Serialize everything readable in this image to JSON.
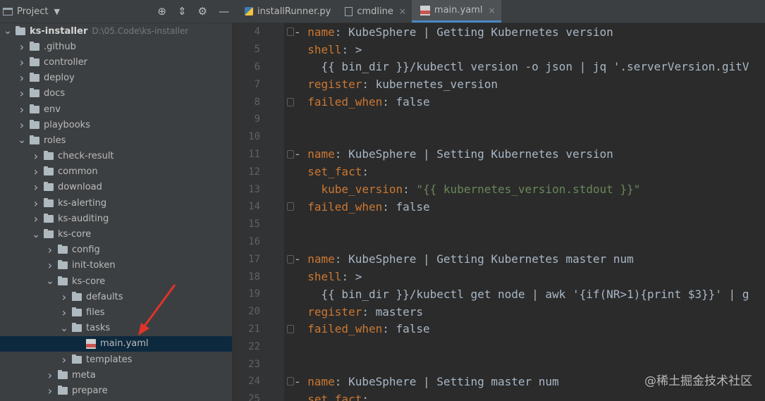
{
  "project_panel": {
    "title": "Project",
    "tree": [
      {
        "label": "ks-installer",
        "path": "D:\\05.Code\\ks-installer",
        "depth": 0,
        "expanded": true,
        "kind": "folder",
        "bold": true
      },
      {
        "label": ".github",
        "depth": 1,
        "expanded": false,
        "kind": "folder"
      },
      {
        "label": "controller",
        "depth": 1,
        "expanded": false,
        "kind": "folder"
      },
      {
        "label": "deploy",
        "depth": 1,
        "expanded": false,
        "kind": "folder"
      },
      {
        "label": "docs",
        "depth": 1,
        "expanded": false,
        "kind": "folder"
      },
      {
        "label": "env",
        "depth": 1,
        "expanded": false,
        "kind": "folder"
      },
      {
        "label": "playbooks",
        "depth": 1,
        "expanded": false,
        "kind": "folder"
      },
      {
        "label": "roles",
        "depth": 1,
        "expanded": true,
        "kind": "folder"
      },
      {
        "label": "check-result",
        "depth": 2,
        "expanded": false,
        "kind": "folder"
      },
      {
        "label": "common",
        "depth": 2,
        "expanded": false,
        "kind": "folder"
      },
      {
        "label": "download",
        "depth": 2,
        "expanded": false,
        "kind": "folder"
      },
      {
        "label": "ks-alerting",
        "depth": 2,
        "expanded": false,
        "kind": "folder"
      },
      {
        "label": "ks-auditing",
        "depth": 2,
        "expanded": false,
        "kind": "folder"
      },
      {
        "label": "ks-core",
        "depth": 2,
        "expanded": true,
        "kind": "folder"
      },
      {
        "label": "config",
        "depth": 3,
        "expanded": false,
        "kind": "folder"
      },
      {
        "label": "init-token",
        "depth": 3,
        "expanded": false,
        "kind": "folder"
      },
      {
        "label": "ks-core",
        "depth": 3,
        "expanded": true,
        "kind": "folder"
      },
      {
        "label": "defaults",
        "depth": 4,
        "expanded": false,
        "kind": "folder"
      },
      {
        "label": "files",
        "depth": 4,
        "expanded": false,
        "kind": "folder"
      },
      {
        "label": "tasks",
        "depth": 4,
        "expanded": true,
        "kind": "folder"
      },
      {
        "label": "main.yaml",
        "depth": 5,
        "kind": "yaml",
        "selected": true
      },
      {
        "label": "templates",
        "depth": 4,
        "expanded": false,
        "kind": "folder"
      },
      {
        "label": "meta",
        "depth": 3,
        "expanded": false,
        "kind": "folder"
      },
      {
        "label": "prepare",
        "depth": 3,
        "expanded": false,
        "kind": "folder"
      }
    ]
  },
  "tabs": [
    {
      "label": "installRunner.py",
      "icon": "python-file-icon",
      "active": false,
      "closable": false
    },
    {
      "label": "cmdline",
      "icon": "text-file-icon",
      "active": false,
      "closable": true
    },
    {
      "label": "main.yaml",
      "icon": "yaml-file-icon",
      "active": true,
      "closable": true
    }
  ],
  "editor": {
    "lines": [
      {
        "n": "4",
        "fold": true,
        "segs": [
          [
            "d",
            "- "
          ],
          [
            "k",
            "name"
          ],
          [
            "d",
            ": KubeSphere | Getting Kubernetes version"
          ]
        ]
      },
      {
        "n": "5",
        "fold": false,
        "segs": [
          [
            "d",
            "  "
          ],
          [
            "k",
            "shell"
          ],
          [
            "d",
            ": >"
          ]
        ]
      },
      {
        "n": "6",
        "fold": false,
        "segs": [
          [
            "d",
            "    {{ bin_dir }}/kubectl version -o json | jq '.serverVersion.gitV"
          ]
        ]
      },
      {
        "n": "7",
        "fold": false,
        "segs": [
          [
            "d",
            "  "
          ],
          [
            "k",
            "register"
          ],
          [
            "d",
            ": kubernetes_version"
          ]
        ]
      },
      {
        "n": "8",
        "fold": true,
        "segs": [
          [
            "d",
            "  "
          ],
          [
            "k",
            "failed_when"
          ],
          [
            "d",
            ": false"
          ]
        ]
      },
      {
        "n": "9",
        "fold": false,
        "segs": []
      },
      {
        "n": "10",
        "fold": false,
        "segs": []
      },
      {
        "n": "11",
        "fold": true,
        "segs": [
          [
            "d",
            "- "
          ],
          [
            "k",
            "name"
          ],
          [
            "d",
            ": KubeSphere | Setting Kubernetes version"
          ]
        ]
      },
      {
        "n": "12",
        "fold": false,
        "segs": [
          [
            "d",
            "  "
          ],
          [
            "k",
            "set_fact"
          ],
          [
            "d",
            ":"
          ]
        ]
      },
      {
        "n": "13",
        "fold": false,
        "segs": [
          [
            "d",
            "    "
          ],
          [
            "k",
            "kube_version"
          ],
          [
            "d",
            ": "
          ],
          [
            "s",
            "\"{{ kubernetes_version.stdout }}\""
          ]
        ]
      },
      {
        "n": "14",
        "fold": true,
        "segs": [
          [
            "d",
            "  "
          ],
          [
            "k",
            "failed_when"
          ],
          [
            "d",
            ": false"
          ]
        ]
      },
      {
        "n": "15",
        "fold": false,
        "segs": []
      },
      {
        "n": "16",
        "fold": false,
        "segs": []
      },
      {
        "n": "17",
        "fold": true,
        "segs": [
          [
            "d",
            "- "
          ],
          [
            "k",
            "name"
          ],
          [
            "d",
            ": KubeSphere | Getting Kubernetes master num"
          ]
        ]
      },
      {
        "n": "18",
        "fold": false,
        "segs": [
          [
            "d",
            "  "
          ],
          [
            "k",
            "shell"
          ],
          [
            "d",
            ": >"
          ]
        ]
      },
      {
        "n": "19",
        "fold": false,
        "segs": [
          [
            "d",
            "    {{ bin_dir }}/kubectl get node | awk '{if(NR>1){print $3}}' | g"
          ]
        ]
      },
      {
        "n": "20",
        "fold": false,
        "segs": [
          [
            "d",
            "  "
          ],
          [
            "k",
            "register"
          ],
          [
            "d",
            ": masters"
          ]
        ]
      },
      {
        "n": "21",
        "fold": true,
        "segs": [
          [
            "d",
            "  "
          ],
          [
            "k",
            "failed_when"
          ],
          [
            "d",
            ": false"
          ]
        ]
      },
      {
        "n": "22",
        "fold": false,
        "segs": []
      },
      {
        "n": "23",
        "fold": false,
        "segs": []
      },
      {
        "n": "24",
        "fold": true,
        "segs": [
          [
            "d",
            "- "
          ],
          [
            "k",
            "name"
          ],
          [
            "d",
            ": KubeSphere | Setting master num"
          ]
        ]
      },
      {
        "n": "25",
        "fold": false,
        "segs": [
          [
            "d",
            "  "
          ],
          [
            "k",
            "set_fact"
          ],
          [
            "d",
            ":"
          ]
        ]
      }
    ]
  },
  "watermark": "@稀土掘金技术社区",
  "colors": {
    "keyword": "#cc7832",
    "string": "#6a8759",
    "default": "#a9b7c6",
    "selection": "#0d293e",
    "arrow": "#e0332a"
  }
}
